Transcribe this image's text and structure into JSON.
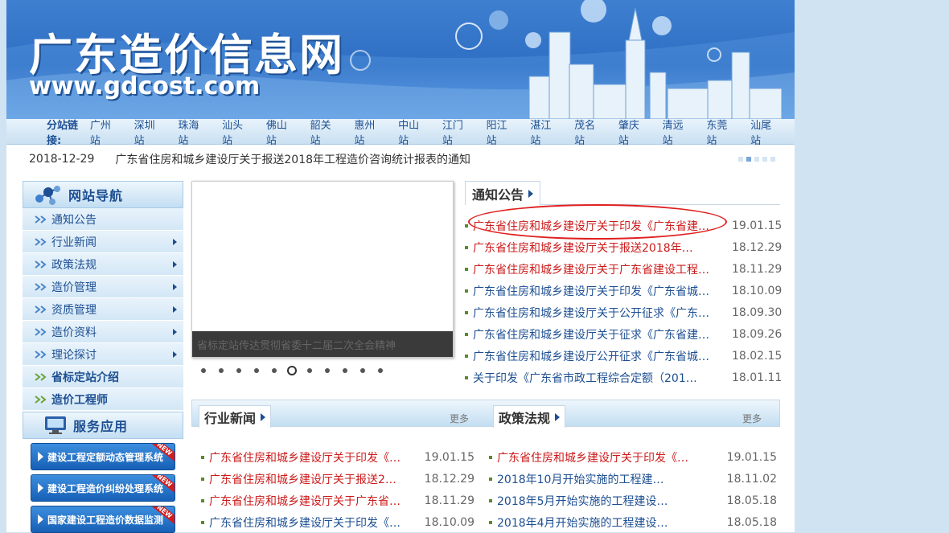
{
  "banner": {
    "title": "广东造价信息网",
    "url": "www.gdcost.com"
  },
  "substations": {
    "label": "分站链接:",
    "items": [
      "广州站",
      "深圳站",
      "珠海站",
      "汕头站",
      "佛山站",
      "韶关站",
      "惠州站",
      "中山站",
      "江门站",
      "阳江站",
      "湛江站",
      "茂名站",
      "肇庆站",
      "清远站",
      "东莞站",
      "汕尾站"
    ]
  },
  "ticker": {
    "date": "2018-12-29",
    "text": "广东省住房和城乡建设厅关于报送2018年工程造价咨询统计报表的通知"
  },
  "leftnav": {
    "title": "网站导航",
    "items": [
      {
        "label": "通知公告"
      },
      {
        "label": "行业新闻"
      },
      {
        "label": "政策法规"
      },
      {
        "label": "造价管理"
      },
      {
        "label": "资质管理"
      },
      {
        "label": "造价资料"
      },
      {
        "label": "理论探讨"
      },
      {
        "label": "省标定站介绍"
      },
      {
        "label": "造价工程师"
      }
    ],
    "service_title": "服务应用",
    "services": [
      {
        "label": "建设工程定额动态管理系统",
        "tag": "NEW"
      },
      {
        "label": "建设工程造价纠纷处理系统",
        "tag": "NEW"
      },
      {
        "label": "国家建设工程造价数据监测",
        "tag": "NEW"
      }
    ]
  },
  "slide": {
    "caption": "省标定站传达贯彻省委十二届二次全会精神"
  },
  "notice": {
    "title": "通知公告",
    "items": [
      {
        "text": "广东省住房和城乡建设厅关于印发《广东省建…",
        "date": "19.01.15",
        "color": "red"
      },
      {
        "text": "广东省住房和城乡建设厅关于报送2018年…",
        "date": "18.12.29",
        "color": "red"
      },
      {
        "text": "广东省住房和城乡建设厅关于广东省建设工程…",
        "date": "18.11.29",
        "color": "red"
      },
      {
        "text": "广东省住房和城乡建设厅关于印发《广东省城…",
        "date": "18.10.09",
        "color": "blue"
      },
      {
        "text": "广东省住房和城乡建设厅关于公开征求《广东…",
        "date": "18.09.30",
        "color": "blue"
      },
      {
        "text": "广东省住房和城乡建设厅关于征求《广东省建…",
        "date": "18.09.26",
        "color": "blue"
      },
      {
        "text": "广东省住房和城乡建设厅公开征求《广东省城…",
        "date": "18.02.15",
        "color": "blue"
      },
      {
        "text": "关于印发《广东省市政工程综合定额（201…",
        "date": "18.01.11",
        "color": "blue"
      }
    ]
  },
  "industry": {
    "title": "行业新闻",
    "more": "更多",
    "items": [
      {
        "text": "广东省住房和城乡建设厅关于印发《…",
        "date": "19.01.15"
      },
      {
        "text": "广东省住房和城乡建设厅关于报送2…",
        "date": "18.12.29"
      },
      {
        "text": "广东省住房和城乡建设厅关于广东省…",
        "date": "18.11.29"
      },
      {
        "text": "广东省住房和城乡建设厅关于印发《…",
        "date": "18.10.09"
      }
    ]
  },
  "policy": {
    "title": "政策法规",
    "more": "更多",
    "items": [
      {
        "text": "广东省住房和城乡建设厅关于印发《…",
        "date": "19.01.15",
        "color": "red"
      },
      {
        "text": "2018年10月开始实施的工程建…",
        "date": "18.11.02",
        "color": "blue"
      },
      {
        "text": "2018年5月开始实施的工程建设…",
        "date": "18.05.18",
        "color": "blue"
      },
      {
        "text": "2018年4月开始实施的工程建设…",
        "date": "18.05.18",
        "color": "blue"
      }
    ]
  },
  "colors": {
    "accent": "#1d4f92",
    "highlight": "#cc1a1a",
    "circle": "#e02020"
  }
}
